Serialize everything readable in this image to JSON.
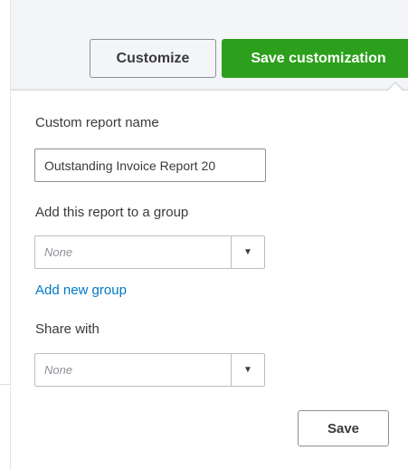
{
  "toolbar": {
    "customize_label": "Customize",
    "save_customization_label": "Save customization"
  },
  "form": {
    "report_name": {
      "label": "Custom report name",
      "value": "Outstanding Invoice Report 20"
    },
    "group": {
      "label": "Add this report to a group",
      "selected": "None",
      "add_link": "Add new group"
    },
    "share": {
      "label": "Share with",
      "selected": "None"
    },
    "save_label": "Save"
  },
  "icons": {
    "dropdown": "chevron-down-icon"
  },
  "colors": {
    "primary_green": "#2ca01c",
    "link_blue": "#0077c5",
    "text_dark": "#393a3d",
    "placeholder_gray": "#8d9096"
  }
}
